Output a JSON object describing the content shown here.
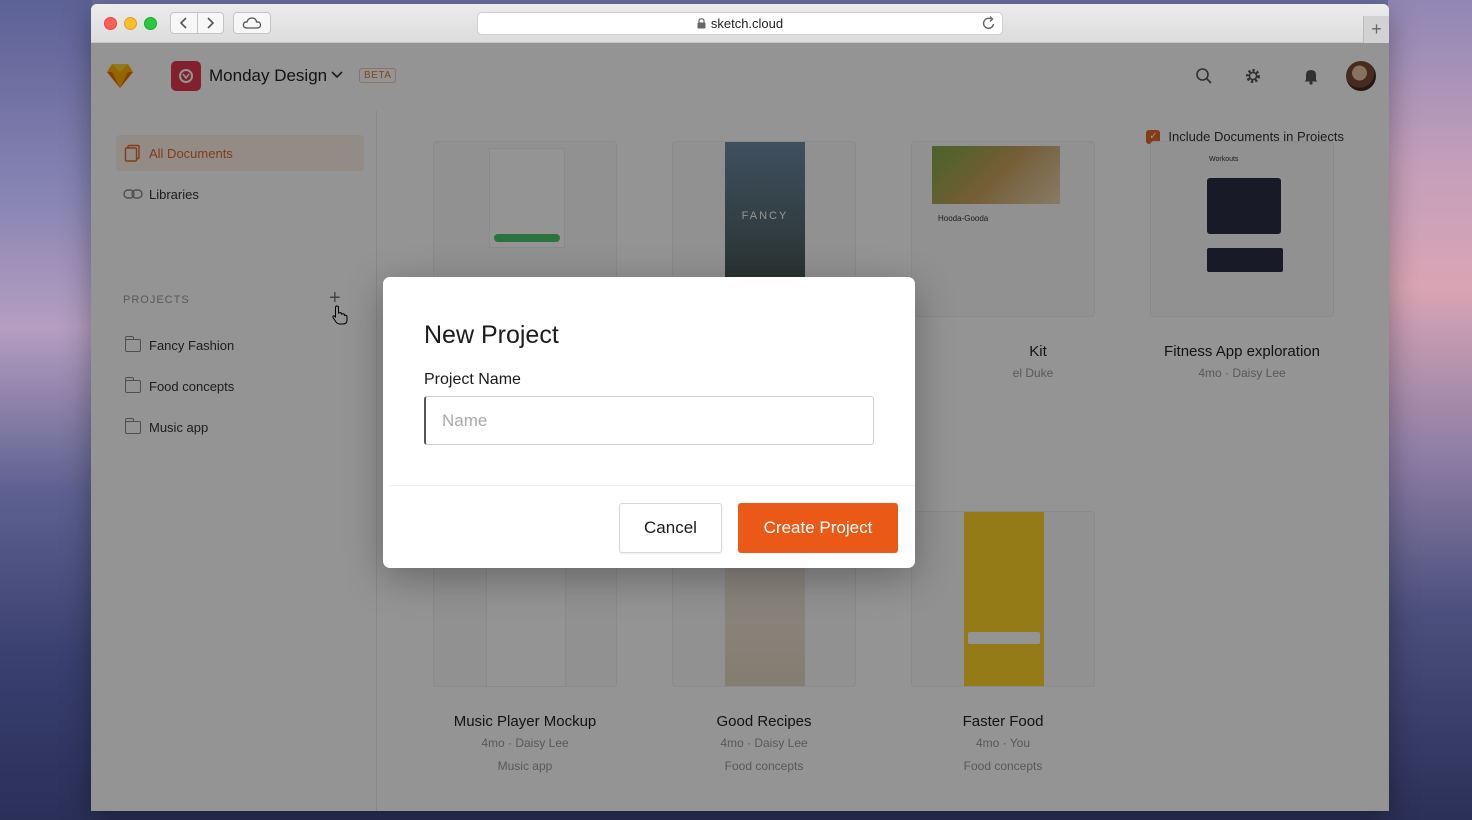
{
  "browser": {
    "url": "sketch.cloud",
    "icons": {
      "back": "chevron-left-icon",
      "forward": "chevron-right-icon",
      "cloud": "cloud-icon",
      "lock": "lock-icon",
      "reload": "reload-icon",
      "newtab": "plus-icon"
    }
  },
  "header": {
    "workspace_name": "Monday Design",
    "beta_label": "BETA",
    "icons": {
      "search": "search-icon",
      "settings": "gear-icon",
      "notifications": "bell-icon"
    }
  },
  "sidebar": {
    "items": [
      {
        "label": "All Documents",
        "icon": "documents-icon",
        "active": true
      },
      {
        "label": "Libraries",
        "icon": "link-icon",
        "active": false
      }
    ],
    "projects_label": "PROJECTS",
    "add_symbol": "+",
    "projects": [
      {
        "label": "Fancy Fashion"
      },
      {
        "label": "Food concepts"
      },
      {
        "label": "Music app"
      }
    ]
  },
  "main": {
    "include_label": "Include Documents in Projects",
    "include_checked": true,
    "cards_row1": [
      {
        "title": "",
        "meta": "",
        "project": ""
      },
      {
        "title": "",
        "meta": "",
        "project": "",
        "thumb_text": "FANCY"
      },
      {
        "title": "Kit",
        "meta": "el Duke",
        "project": "",
        "thumb_text": "Hooda-Gooda"
      },
      {
        "title": "Fitness App exploration",
        "meta": "4mo · Daisy Lee",
        "project": "",
        "thumb_text": "Workouts"
      }
    ],
    "cards_row2": [
      {
        "title": "Music Player Mockup",
        "meta": "4mo · Daisy Lee",
        "project": "Music app"
      },
      {
        "title": "Good Recipes",
        "meta": "4mo · Daisy Lee",
        "project": "Food concepts"
      },
      {
        "title": "Faster Food",
        "meta": "4mo · You",
        "project": "Food concepts"
      }
    ]
  },
  "modal": {
    "title": "New Project",
    "field_label": "Project Name",
    "input_value": "",
    "input_placeholder": "Name",
    "cancel_label": "Cancel",
    "create_label": "Create Project",
    "accent_color": "#ea5a16"
  }
}
